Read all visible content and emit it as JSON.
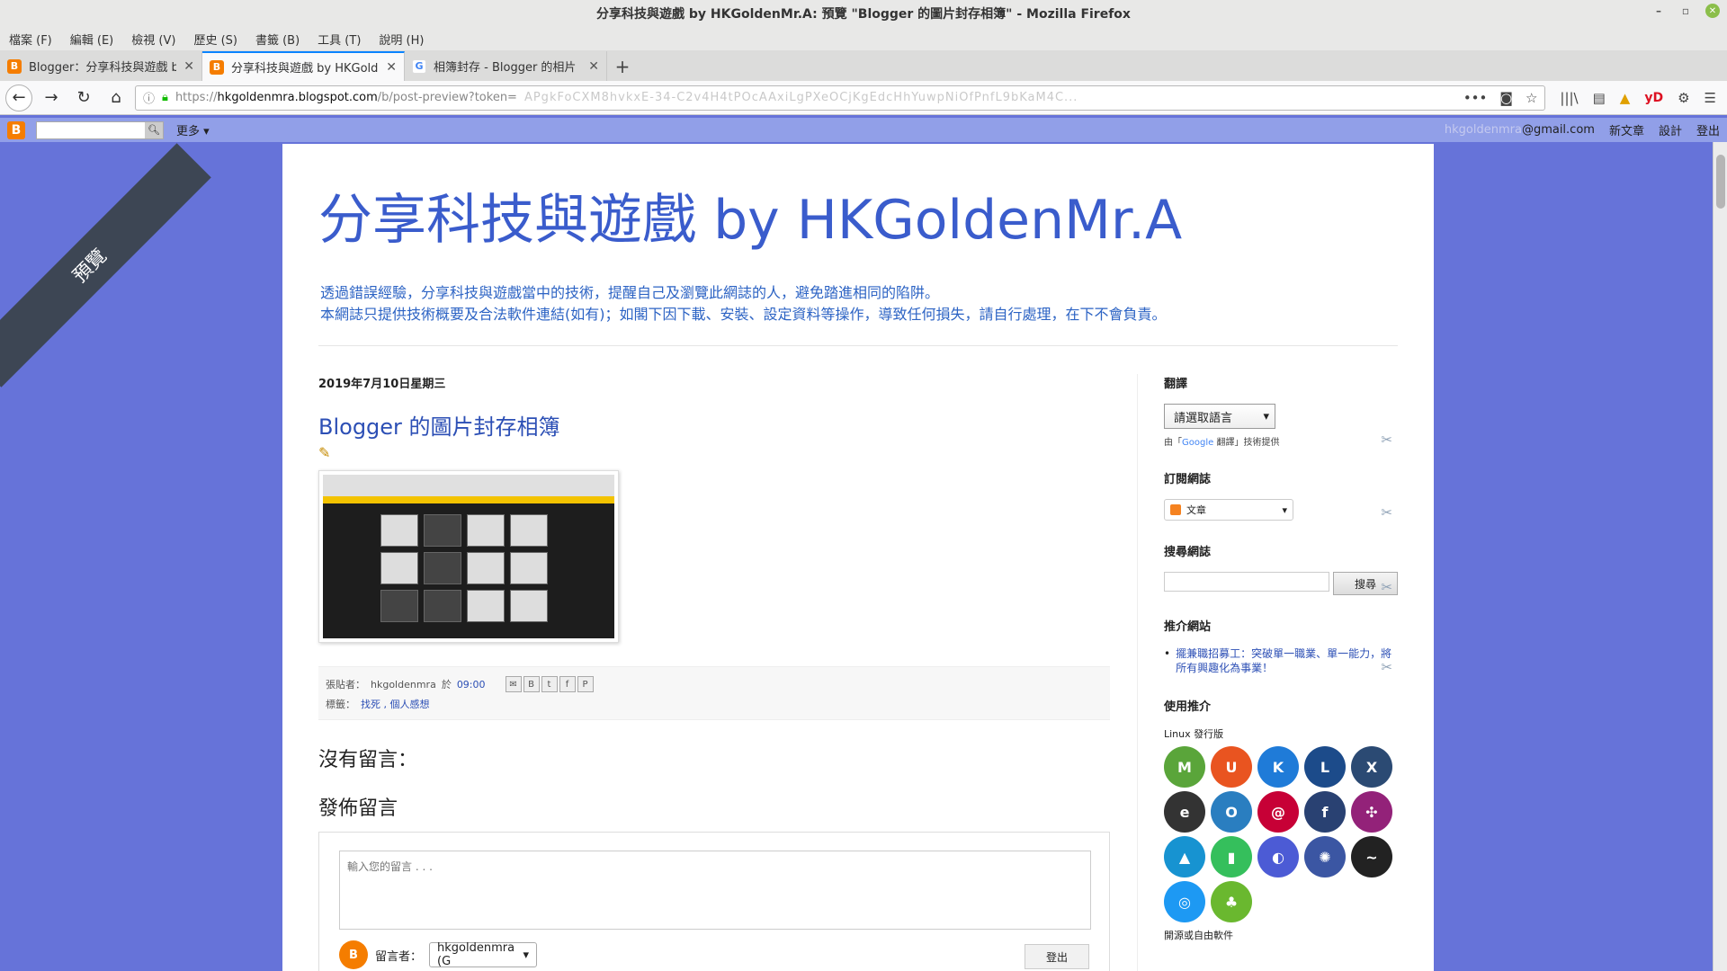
{
  "window": {
    "title": "分享科技與遊戲 by HKGoldenMr.A: 預覽 \"Blogger 的圖片封存相簿\" - Mozilla Firefox",
    "controls": [
      "–",
      "▫",
      "✕"
    ]
  },
  "menu": [
    "檔案 (F)",
    "編輯 (E)",
    "檢視 (V)",
    "歷史 (S)",
    "書籤 (B)",
    "工具 (T)",
    "說明 (H)"
  ],
  "tabs": [
    {
      "label": "Blogger：分享科技與遊戲 by HKG",
      "favicon": "B"
    },
    {
      "label": "分享科技與遊戲 by HKGoldenMr.A",
      "favicon": "B"
    },
    {
      "label": "相簿封存 - Blogger 的相片",
      "favicon": "G"
    }
  ],
  "url": {
    "scheme": "https://",
    "host": "hkgoldenmra.blogspot.com",
    "path": "/b/post-preview?token=",
    "blurred": "APgkFoCXM8hvkxE-34-C2v4H4tPOcAAxiLgPXeOCjKgEdcHhYuwpNiOfPnfL9bKaM4C..."
  },
  "blogger_nav": {
    "more": "更多",
    "email": "@gmail.com",
    "email_blur": "hkgoldenmra",
    "new_post": "新文章",
    "design": "設計",
    "sign_out": "登出"
  },
  "ribbon": "預覽",
  "blog": {
    "title": "分享科技與遊戲 by HKGoldenMr.A",
    "desc1": "透過錯誤經驗，分享科技與遊戲當中的技術，提醒自己及瀏覽此網誌的人，避免踏進相同的陷阱。",
    "desc2": "本網誌只提供技術概要及合法軟件連結(如有)；如閣下因下載、安裝、設定資料等操作，導致任何損失，請自行處理，在下不會負責。"
  },
  "post": {
    "date": "2019年7月10日星期三",
    "title": "Blogger 的圖片封存相簿",
    "posted_by_label": "張貼者：",
    "author": "hkgoldenmra",
    "at_label": "於",
    "time": "09:00",
    "labels_label": "標籤：",
    "labels": "找死 , 個人感想",
    "no_comments": "沒有留言：",
    "post_comment": "發佈留言",
    "comment_placeholder": "輸入您的留言 . . .",
    "commenter_label": "留言者：",
    "commenter_value": "hkgoldenmra (G",
    "logout": "登出"
  },
  "sidebar": {
    "translate_title": "翻譯",
    "translate_select": "請選取語言",
    "powered_by_prefix": "由「",
    "powered_google": "Google",
    "powered_by_suffix": " 翻譯」技術提供",
    "subscribe_title": "訂閱網誌",
    "subscribe_select": "文章",
    "search_title": "搜尋網誌",
    "search_button": "搜尋",
    "reco_title": "推介網站",
    "reco_link": "擺兼職招募工：突破單一職業、單一能力，將所有興趣化為事業！",
    "use_title": "使用推介",
    "linux_label": "Linux 發行版",
    "more_label": "開源或自由軟件"
  },
  "distros": [
    {
      "name": "linux-mint-icon",
      "color": "#5aa53a",
      "glyph": "M"
    },
    {
      "name": "ubuntu-icon",
      "color": "#e95420",
      "glyph": "U"
    },
    {
      "name": "kubuntu-icon",
      "color": "#1f7bd8",
      "glyph": "K"
    },
    {
      "name": "lubuntu-icon",
      "color": "#1c4b8a",
      "glyph": "L"
    },
    {
      "name": "xubuntu-icon",
      "color": "#2b4a73",
      "glyph": "X"
    },
    {
      "name": "elementary-icon",
      "color": "#333333",
      "glyph": "e"
    },
    {
      "name": "opensuse-icon",
      "color": "#2a7ec0",
      "glyph": "O"
    },
    {
      "name": "debian-icon",
      "color": "#c70036",
      "glyph": "@"
    },
    {
      "name": "fedora-icon",
      "color": "#294172",
      "glyph": "f"
    },
    {
      "name": "centos-icon",
      "color": "#932279",
      "glyph": "✣"
    },
    {
      "name": "arch-icon",
      "color": "#1793d1",
      "glyph": "▲"
    },
    {
      "name": "manjaro-icon",
      "color": "#35bf5c",
      "glyph": "▮"
    },
    {
      "name": "mageia-icon",
      "color": "#4c5bd5",
      "glyph": "◐"
    },
    {
      "name": "sabayon-icon",
      "color": "#3b56a3",
      "glyph": "✺"
    },
    {
      "name": "kali-icon",
      "color": "#222222",
      "glyph": "~"
    },
    {
      "name": "kde-neon-icon",
      "color": "#1d99f3",
      "glyph": "◎"
    },
    {
      "name": "clover-icon",
      "color": "#6ab82f",
      "glyph": "♣"
    }
  ]
}
